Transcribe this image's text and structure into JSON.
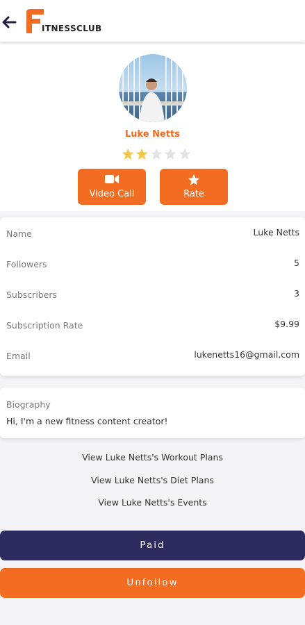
{
  "header": {
    "logo_text": "ITNESSCLUB",
    "back_icon": "arrow-left-icon"
  },
  "profile": {
    "name": "Luke Netts",
    "rating": 2,
    "rating_max": 5,
    "actions": {
      "video_call_label": "Video Call",
      "rate_label": "Rate"
    }
  },
  "info": {
    "rows": [
      {
        "label": "Name",
        "value": "Luke Netts"
      },
      {
        "label": "Followers",
        "value": "5"
      },
      {
        "label": "Subscribers",
        "value": "3"
      },
      {
        "label": "Subscription Rate",
        "value": "$9.99"
      },
      {
        "label": "Email",
        "value": "lukenetts16@gmail.com"
      }
    ]
  },
  "biography": {
    "label": "Biography",
    "text": "Hi, I'm a new fitness content creator!"
  },
  "links": {
    "workout_plans": "View Luke Netts's Workout Plans",
    "diet_plans": "View Luke Netts's Diet Plans",
    "events": "View Luke Netts's Events"
  },
  "buttons": {
    "paid": "Paid",
    "unfollow": "Unfollow"
  },
  "colors": {
    "accent": "#f26c21",
    "primary_dark": "#2e2b5f",
    "star_filled": "#f2c94c",
    "star_empty": "#e3e3e3"
  }
}
